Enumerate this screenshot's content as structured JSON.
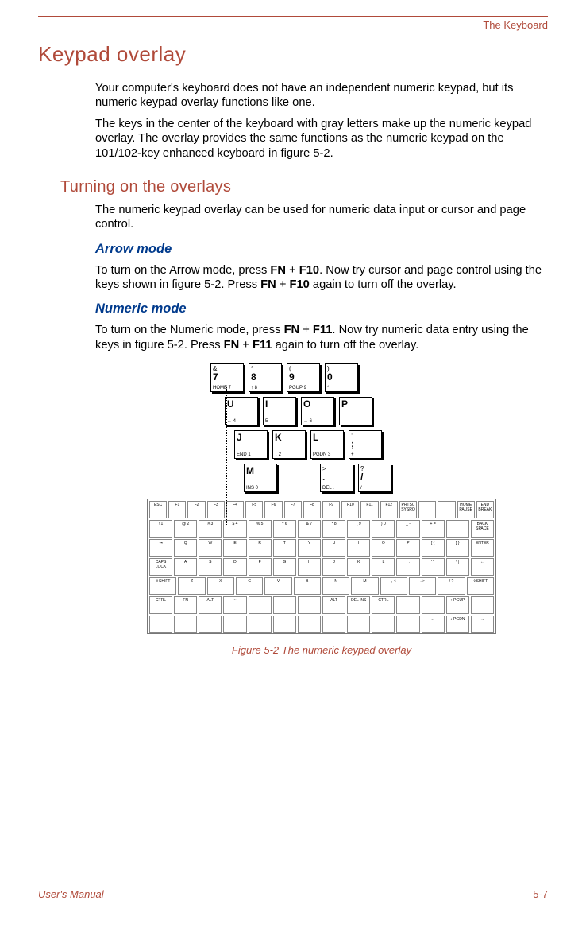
{
  "header": {
    "section": "The Keyboard"
  },
  "h1": "Keypad overlay",
  "intro": {
    "p1": "Your computer's keyboard does not have an independent numeric keypad, but its numeric keypad overlay functions like one.",
    "p2": "The keys in the center of the keyboard with gray letters make up the numeric keypad overlay. The overlay provides the same functions as the numeric keypad on the 101/102-key enhanced keyboard in figure 5-2."
  },
  "h2": "Turning on the overlays",
  "overlays_intro": "The numeric keypad overlay can be used for numeric data input or cursor and page control.",
  "arrow": {
    "title": "Arrow mode",
    "p_parts": [
      "To turn on the Arrow mode, press ",
      "FN",
      " + ",
      "F10",
      ". Now try cursor and page control using the keys shown in figure 5-2. Press ",
      "FN",
      " + ",
      "F10",
      " again to turn off the overlay."
    ]
  },
  "numeric": {
    "title": "Numeric mode",
    "p_parts": [
      "To turn on the Numeric mode, press ",
      "FN",
      " + ",
      "F11",
      ". Now try numeric data entry using the keys in figure 5-2. Press ",
      "FN",
      " + ",
      "F11",
      " again to turn off the overlay."
    ]
  },
  "figure": {
    "caption": "Figure 5-2 The numeric keypad overlay"
  },
  "footer": {
    "left": "User's Manual",
    "right": "5-7"
  },
  "overlay_keys": {
    "r1": [
      {
        "t": "&",
        "m": "7",
        "s": "HOME 7"
      },
      {
        "t": "*",
        "m": "8",
        "s": "↑ 8"
      },
      {
        "t": "(",
        "m": "9",
        "s": "PGUP 9"
      },
      {
        "t": ")",
        "m": "0",
        "s": "*"
      }
    ],
    "r2": [
      {
        "m": "U",
        "s": "← 4"
      },
      {
        "m": "I",
        "s": "5"
      },
      {
        "m": "O",
        "s": "→ 6"
      },
      {
        "m": "P",
        "s": "-"
      }
    ],
    "r3": [
      {
        "m": "J",
        "s": "END 1"
      },
      {
        "m": "K",
        "s": "↓ 2"
      },
      {
        "m": "L",
        "s": "PGDN 3"
      },
      {
        "t": ":",
        "m": ";",
        "s": "+"
      }
    ],
    "r4": [
      {
        "m": "M",
        "s": "INS 0"
      },
      null,
      {
        "t": ">",
        "m": ".",
        "s": "DEL ."
      },
      {
        "t": "?",
        "m": "/",
        "s": "/"
      }
    ]
  },
  "full_keyboard_rows": [
    [
      "ESC",
      "F1",
      "F2",
      "F3",
      "F4",
      "F5",
      "F6",
      "F7",
      "F8",
      "F9",
      "F10",
      "F11",
      "F12",
      "PRTSC SYSRQ",
      "",
      "",
      "HOME PAUSE",
      "END BREAK"
    ],
    [
      "! 1",
      "@ 2",
      "# 3",
      "$ 4",
      "% 5",
      "^ 6",
      "& 7",
      "* 8",
      "( 9",
      ") 0",
      "_ -",
      "+ =",
      "",
      "BACK SPACE"
    ],
    [
      "⇥",
      "Q",
      "W",
      "E",
      "R",
      "T",
      "Y",
      "U",
      "I",
      "O",
      "P",
      "[ {",
      "] }",
      "ENTER"
    ],
    [
      "CAPS LOCK",
      "A",
      "S",
      "D",
      "F",
      "G",
      "H",
      "J",
      "K",
      "L",
      "; :",
      "' \"",
      "\\ |",
      "←"
    ],
    [
      "⇧SHIFT",
      "Z",
      "X",
      "C",
      "V",
      "B",
      "N",
      "M",
      ", <",
      ". >",
      "/ ?",
      "⇧SHIFT"
    ],
    [
      "CTRL",
      "FN",
      "ALT",
      "~",
      "",
      "",
      "",
      "ALT",
      "DEL INS",
      "CTRL",
      "",
      "",
      "↑ PGUP",
      ""
    ],
    [
      "",
      "",
      "",
      "",
      "",
      "",
      "",
      "",
      "",
      "",
      "",
      "←",
      "↓ PGDN",
      "→"
    ]
  ]
}
